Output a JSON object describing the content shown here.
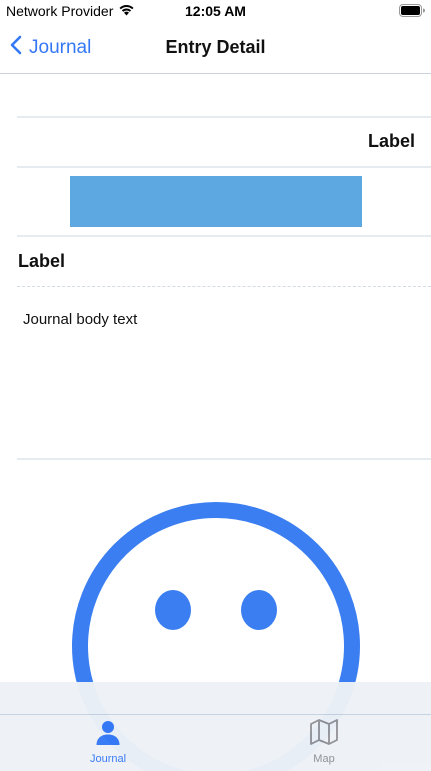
{
  "status_bar": {
    "carrier": "Network Provider",
    "time": "12:05 AM",
    "icons": [
      "wifi-icon",
      "battery-icon"
    ]
  },
  "nav": {
    "back_label": "Journal",
    "title": "Entry Detail",
    "back_icon": "chevron-left-icon"
  },
  "content": {
    "label_top": "Label",
    "label_second": "Label",
    "body_text": "Journal body text",
    "placeholder_image": "smiley-face-icon"
  },
  "tabs": [
    {
      "label": "Journal",
      "icon": "person-icon",
      "selected": true
    },
    {
      "label": "Map",
      "icon": "map-icon",
      "selected": false
    }
  ],
  "colors": {
    "accent": "#3478f6",
    "block": "#5ea8e2",
    "smiley": "#3a7ef1",
    "tab_inactive": "#8e8e93"
  }
}
